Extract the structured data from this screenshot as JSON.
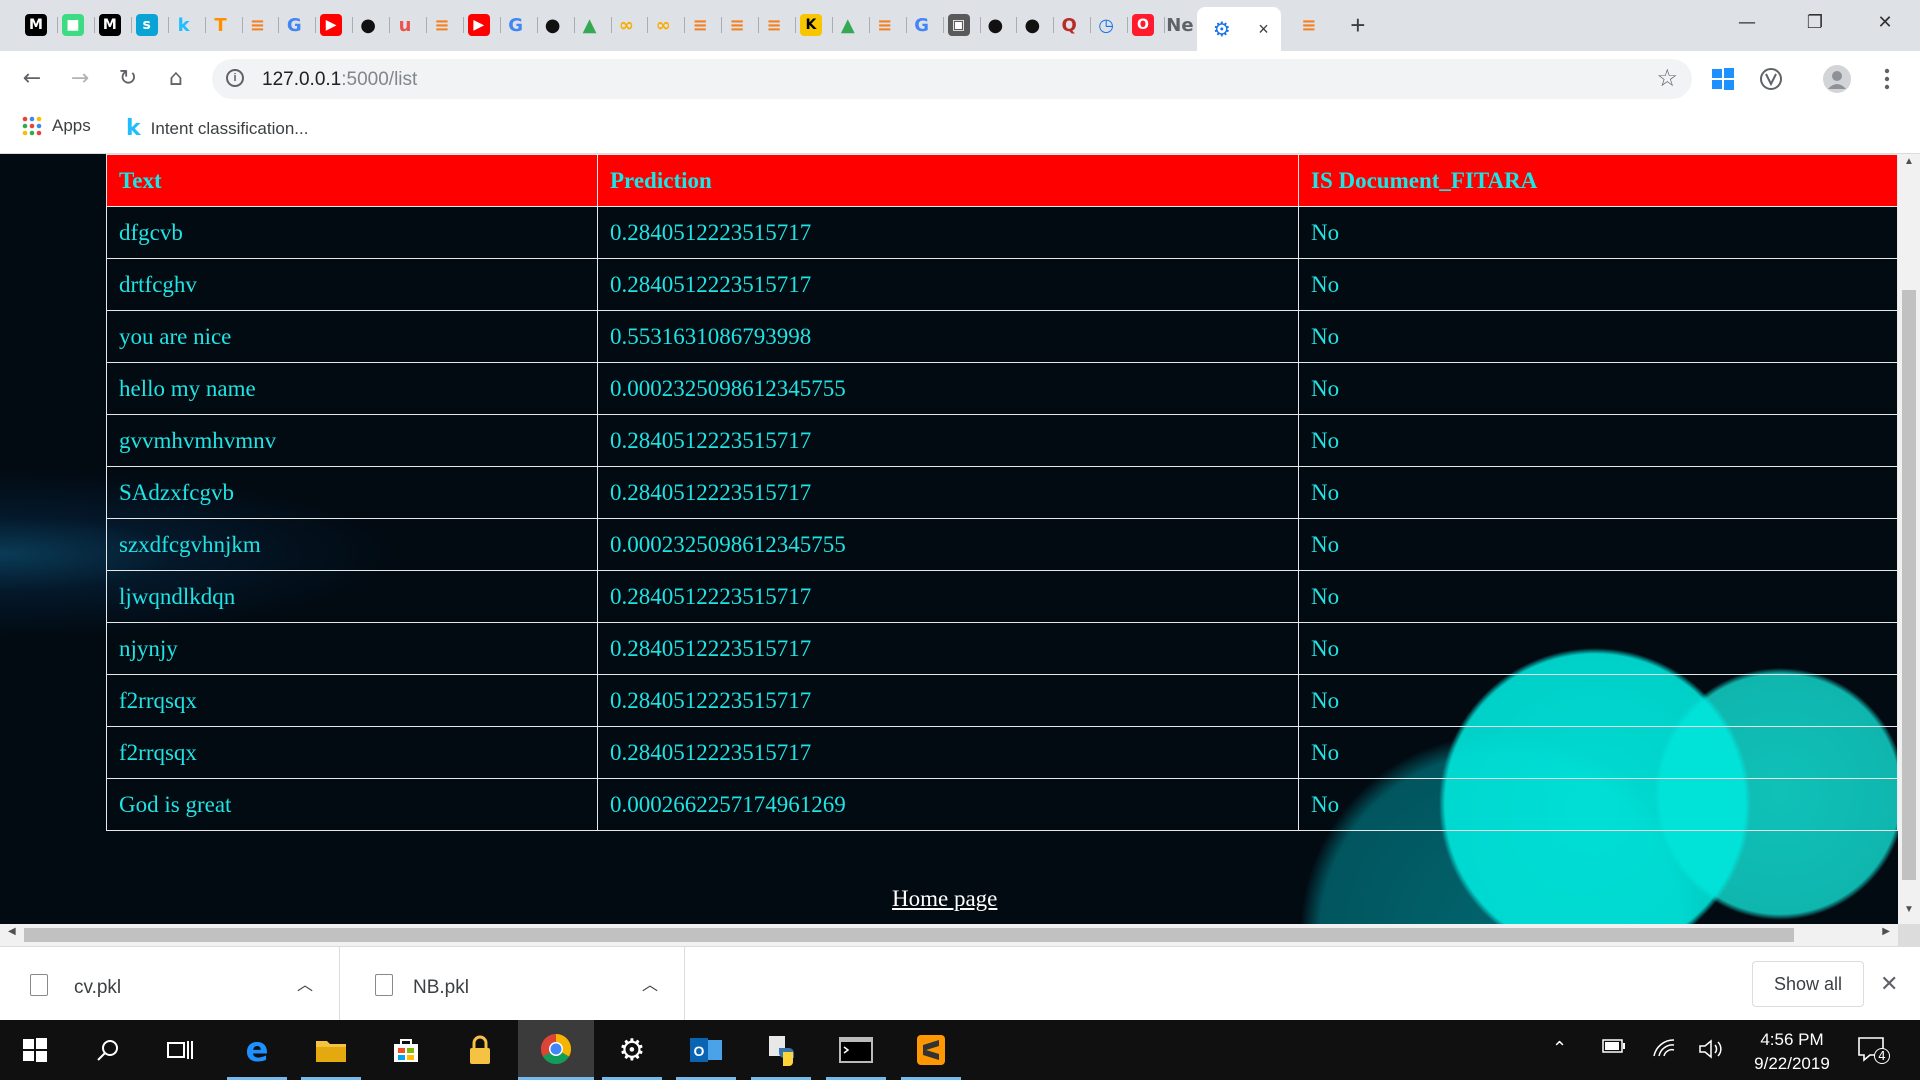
{
  "browser": {
    "tabs": [
      {
        "icon": "medium-icon",
        "glyph": "M",
        "bg": "#000000",
        "fg": "#ffffff"
      },
      {
        "icon": "android-icon",
        "glyph": "■",
        "bg": "#3ddc84",
        "fg": "#ffffff"
      },
      {
        "icon": "medium-icon",
        "glyph": "M",
        "bg": "#000000",
        "fg": "#ffffff"
      },
      {
        "icon": "spacy-icon",
        "glyph": "s",
        "bg": "#09a3d5",
        "fg": "#ffffff"
      },
      {
        "icon": "kaggle-icon",
        "glyph": "k",
        "bg": "#ffffff",
        "fg": "#20beff"
      },
      {
        "icon": "tensorflow-icon",
        "glyph": "T",
        "bg": "#ffffff",
        "fg": "#ff8f00"
      },
      {
        "icon": "stackoverflow-icon",
        "glyph": "≡",
        "bg": "#ffffff",
        "fg": "#f48024"
      },
      {
        "icon": "google-icon",
        "glyph": "G",
        "bg": "#ffffff",
        "fg": "#4285f4"
      },
      {
        "icon": "youtube-icon",
        "glyph": "▶",
        "bg": "#ff0000",
        "fg": "#ffffff"
      },
      {
        "icon": "github-icon",
        "glyph": "●",
        "bg": "#ffffff",
        "fg": "#111111"
      },
      {
        "icon": "udemy-icon",
        "glyph": "u",
        "bg": "#ffffff",
        "fg": "#ec5252"
      },
      {
        "icon": "stackoverflow-icon",
        "glyph": "≡",
        "bg": "#ffffff",
        "fg": "#f48024"
      },
      {
        "icon": "youtube-icon",
        "glyph": "▶",
        "bg": "#ff0000",
        "fg": "#ffffff"
      },
      {
        "icon": "google-icon",
        "glyph": "G",
        "bg": "#ffffff",
        "fg": "#4285f4"
      },
      {
        "icon": "github-icon",
        "glyph": "●",
        "bg": "#ffffff",
        "fg": "#111111"
      },
      {
        "icon": "google-drive-icon",
        "glyph": "▲",
        "bg": "#ffffff",
        "fg": "#34a853"
      },
      {
        "icon": "colab-icon",
        "glyph": "∞",
        "bg": "#ffffff",
        "fg": "#f9ab00"
      },
      {
        "icon": "colab-icon",
        "glyph": "∞",
        "bg": "#ffffff",
        "fg": "#f9ab00"
      },
      {
        "icon": "stackoverflow-icon",
        "glyph": "≡",
        "bg": "#ffffff",
        "fg": "#f48024"
      },
      {
        "icon": "stackoverflow-icon",
        "glyph": "≡",
        "bg": "#ffffff",
        "fg": "#f48024"
      },
      {
        "icon": "stackoverflow-icon",
        "glyph": "≡",
        "bg": "#ffffff",
        "fg": "#f48024"
      },
      {
        "icon": "k-icon",
        "glyph": "K",
        "bg": "#f7c600",
        "fg": "#000000"
      },
      {
        "icon": "google-drive-icon",
        "glyph": "▲",
        "bg": "#ffffff",
        "fg": "#34a853"
      },
      {
        "icon": "stackoverflow-icon",
        "glyph": "≡",
        "bg": "#ffffff",
        "fg": "#f48024"
      },
      {
        "icon": "google-icon",
        "glyph": "G",
        "bg": "#ffffff",
        "fg": "#4285f4"
      },
      {
        "icon": "person-icon",
        "glyph": "▣",
        "bg": "#5a5a5a",
        "fg": "#ffffff"
      },
      {
        "icon": "github-icon",
        "glyph": "●",
        "bg": "#ffffff",
        "fg": "#111111"
      },
      {
        "icon": "github-icon",
        "glyph": "●",
        "bg": "#ffffff",
        "fg": "#111111"
      },
      {
        "icon": "quora-icon",
        "glyph": "Q",
        "bg": "#ffffff",
        "fg": "#b92b27"
      },
      {
        "icon": "history-icon",
        "glyph": "◷",
        "bg": "#ffffff",
        "fg": "#1a73e8"
      },
      {
        "icon": "opera-icon",
        "glyph": "O",
        "bg": "#ff1b2d",
        "fg": "#ffffff"
      },
      {
        "icon": "ne-icon",
        "glyph": "Ne",
        "bg": "#dee1e6",
        "fg": "#5f6368"
      }
    ],
    "active_tab": {
      "icon": "settings-gear-icon",
      "glyph": "⚙",
      "fg": "#1a73e8",
      "close": "×"
    },
    "trailing_tab": {
      "icon": "stackoverflow-icon",
      "glyph": "≡",
      "fg": "#f48024"
    },
    "new_tab_glyph": "+",
    "window_controls": {
      "minimize": "—",
      "restore": "❐",
      "close": "✕"
    },
    "nav": {
      "back": "←",
      "forward": "→",
      "reload": "↻",
      "home": "⌂"
    },
    "url": {
      "host": "127.0.0.1",
      "path": ":5000/list",
      "info_glyph": "i"
    },
    "bookmark_star": "☆",
    "bookmarks": {
      "apps_label": "Apps",
      "item_label": "Intent classification..."
    }
  },
  "page": {
    "columns": [
      "Text",
      "Prediction",
      "IS Document_FITARA"
    ],
    "rows": [
      [
        "dfgcvb",
        "0.2840512223515717",
        "No"
      ],
      [
        "drtfcghv",
        "0.2840512223515717",
        "No"
      ],
      [
        "you are nice",
        "0.5531631086793998",
        "No"
      ],
      [
        "hello my name",
        "0.0002325098612345755",
        "No"
      ],
      [
        "gvvmhvmhvmnv",
        "0.2840512223515717",
        "No"
      ],
      [
        "SAdzxfcgvb",
        "0.2840512223515717",
        "No"
      ],
      [
        "szxdfcgvhnjkm",
        "0.0002325098612345755",
        "No"
      ],
      [
        "ljwqndlkdqn",
        "0.2840512223515717",
        "No"
      ],
      [
        "njynjy",
        "0.2840512223515717",
        "No"
      ],
      [
        "f2rrqsqx",
        "0.2840512223515717",
        "No"
      ],
      [
        "f2rrqsqx",
        "0.2840512223515717",
        "No"
      ],
      [
        "God is great",
        "0.0002662257174961269",
        "No"
      ]
    ],
    "home_link": "Home page"
  },
  "downloads": {
    "items": [
      {
        "name": "cv.pkl"
      },
      {
        "name": "NB.pkl"
      }
    ],
    "show_all": "Show all",
    "close": "✕",
    "caret": "︿"
  },
  "taskbar": {
    "clock_time": "4:56 PM",
    "clock_date": "9/22/2019",
    "notification_count": "4"
  }
}
